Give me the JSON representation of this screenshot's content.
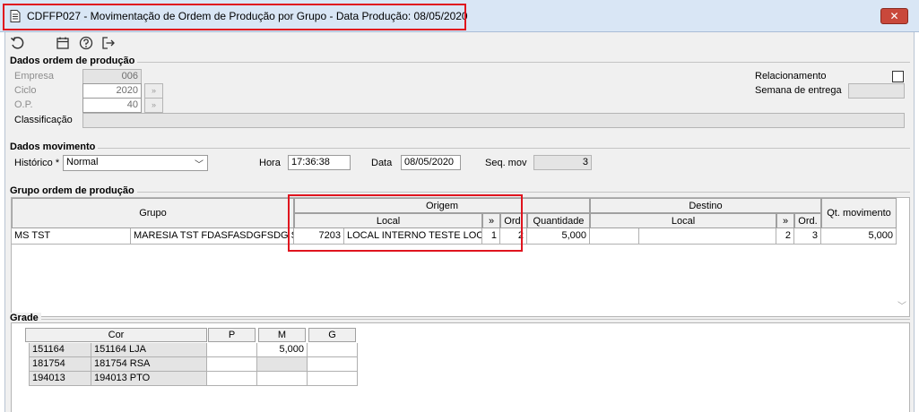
{
  "window": {
    "title": "CDFFP027 - Movimentação de Ordem de Produção por Grupo - Data Produção: 08/05/2020",
    "close_label": "✕"
  },
  "icons": {
    "refresh": "refresh-icon",
    "calendar": "calendar-icon",
    "help": "help-icon",
    "exit": "exit-icon",
    "document": "document-icon"
  },
  "colors": {
    "highlight": "#e0141e",
    "titlebar": "#d9e6f5",
    "close": "#c9483b"
  },
  "dados_ordem": {
    "title": "Dados ordem de produção",
    "empresa_label": "Empresa",
    "empresa_value": "006",
    "ciclo_label": "Ciclo",
    "ciclo_value": "2020",
    "op_label": "O.P.",
    "op_value": "40",
    "classificacao_label": "Classificação",
    "classificacao_value": "",
    "relacionamento_label": "Relacionamento",
    "semana_label": "Semana de entrega",
    "semana_value": ""
  },
  "dados_movimento": {
    "title": "Dados movimento",
    "historico_label": "Histórico *",
    "historico_value": "Normal",
    "hora_label": "Hora",
    "hora_value": "17:36:38",
    "data_label": "Data",
    "data_value": "08/05/2020",
    "seq_label": "Seq. mov",
    "seq_value": "3"
  },
  "grupo_ordem": {
    "title": "Grupo ordem de produção",
    "headers": {
      "grupo": "Grupo",
      "origem": "Origem",
      "destino": "Destino",
      "local": "Local",
      "arrows": "»",
      "ord": "Ord.",
      "quantidade": "Quantidade",
      "qt_movimento": "Qt. movimento"
    },
    "rows": [
      {
        "grupo_code": "MS TST",
        "grupo_desc": "MARESIA TST FDASFASDGFSDG S",
        "origem_local_code": "7203",
        "origem_local_name": "LOCAL INTERNO TESTE LOCAL",
        "origem_arrow": "1",
        "origem_ord": "2",
        "quantidade": "5,000",
        "destino_local_code": "",
        "destino_local_name": "",
        "destino_arrow": "2",
        "destino_ord": "3",
        "qt_movimento": "5,000"
      }
    ]
  },
  "grade": {
    "title": "Grade",
    "headers": [
      "Cor",
      "P",
      "M",
      "G"
    ],
    "rows": [
      {
        "code": "151164",
        "name": "151164 LJA",
        "p": "",
        "m": "5,000",
        "g": ""
      },
      {
        "code": "181754",
        "name": "181754 RSA",
        "p": "",
        "m": "",
        "g": ""
      },
      {
        "code": "194013",
        "name": "194013 PTO",
        "p": "",
        "m": "",
        "g": ""
      }
    ]
  }
}
